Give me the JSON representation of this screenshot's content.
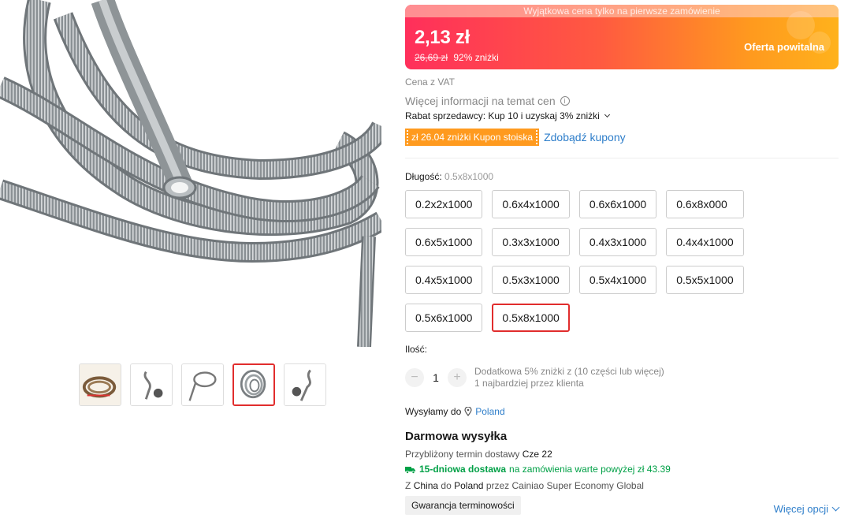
{
  "promo": {
    "banner_text": "Wyjątkowa cena tylko na pierwsze zamówienie",
    "price": "2,13 zł",
    "old_price": "26,69 zł",
    "discount": "92% zniżki",
    "offer_label": "Oferta powitalna"
  },
  "price_info": {
    "vat": "Cena z VAT",
    "more_info": "Więcej informacji na temat cen",
    "seller_discount": "Rabat sprzedawcy: Kup 10 i uzyskaj 3% zniżki"
  },
  "coupon": {
    "badge": "zł 26.04 zniżki Kupon stoiska",
    "link": "Zdobądź kupony"
  },
  "length": {
    "label": "Długość:",
    "selected": "0.5x8x1000",
    "options": [
      "0.2x2x1000",
      "0.6x4x1000",
      "0.6x6x1000",
      "0.6x8x000",
      "0.6x5x1000",
      "0.3x3x1000",
      "0.4x3x1000",
      "0.4x4x1000",
      "0.4x5x1000",
      "0.5x3x1000",
      "0.5x4x1000",
      "0.5x5x1000",
      "0.5x6x1000",
      "0.5x8x1000"
    ]
  },
  "quantity": {
    "label": "Ilość:",
    "value": "1",
    "minus": "−",
    "plus": "+",
    "note_line1": "Dodatkowa 5% zniżki z (10 części lub więcej)",
    "note_line2": "1 najbardziej przez klienta"
  },
  "shipping": {
    "ship_to_label": "Wysyłamy do",
    "country": "Poland",
    "free_title": "Darmowa wysyłka",
    "est_label": "Przybliżony termin dostawy",
    "est_date": "Cze 22",
    "fast_bold": "15-dniowa dostawa",
    "fast_rest": "na zamówienia warte powyżej zł 43.39",
    "route_from_label": "Z",
    "route_from": "China",
    "route_to_label": "do",
    "route_to": "Poland",
    "route_carrier": "przez Cainiao Super Economy Global",
    "guarantee": "Gwarancja terminowości",
    "more_options": "Więcej opcji"
  },
  "gallery": {
    "selected_index": 3,
    "thumb_count": 5
  },
  "colors": {
    "accent_red": "#e12d2d",
    "link_blue": "#2e7eca",
    "coupon_orange": "#ff9a1e",
    "fast_green": "#00a046"
  }
}
